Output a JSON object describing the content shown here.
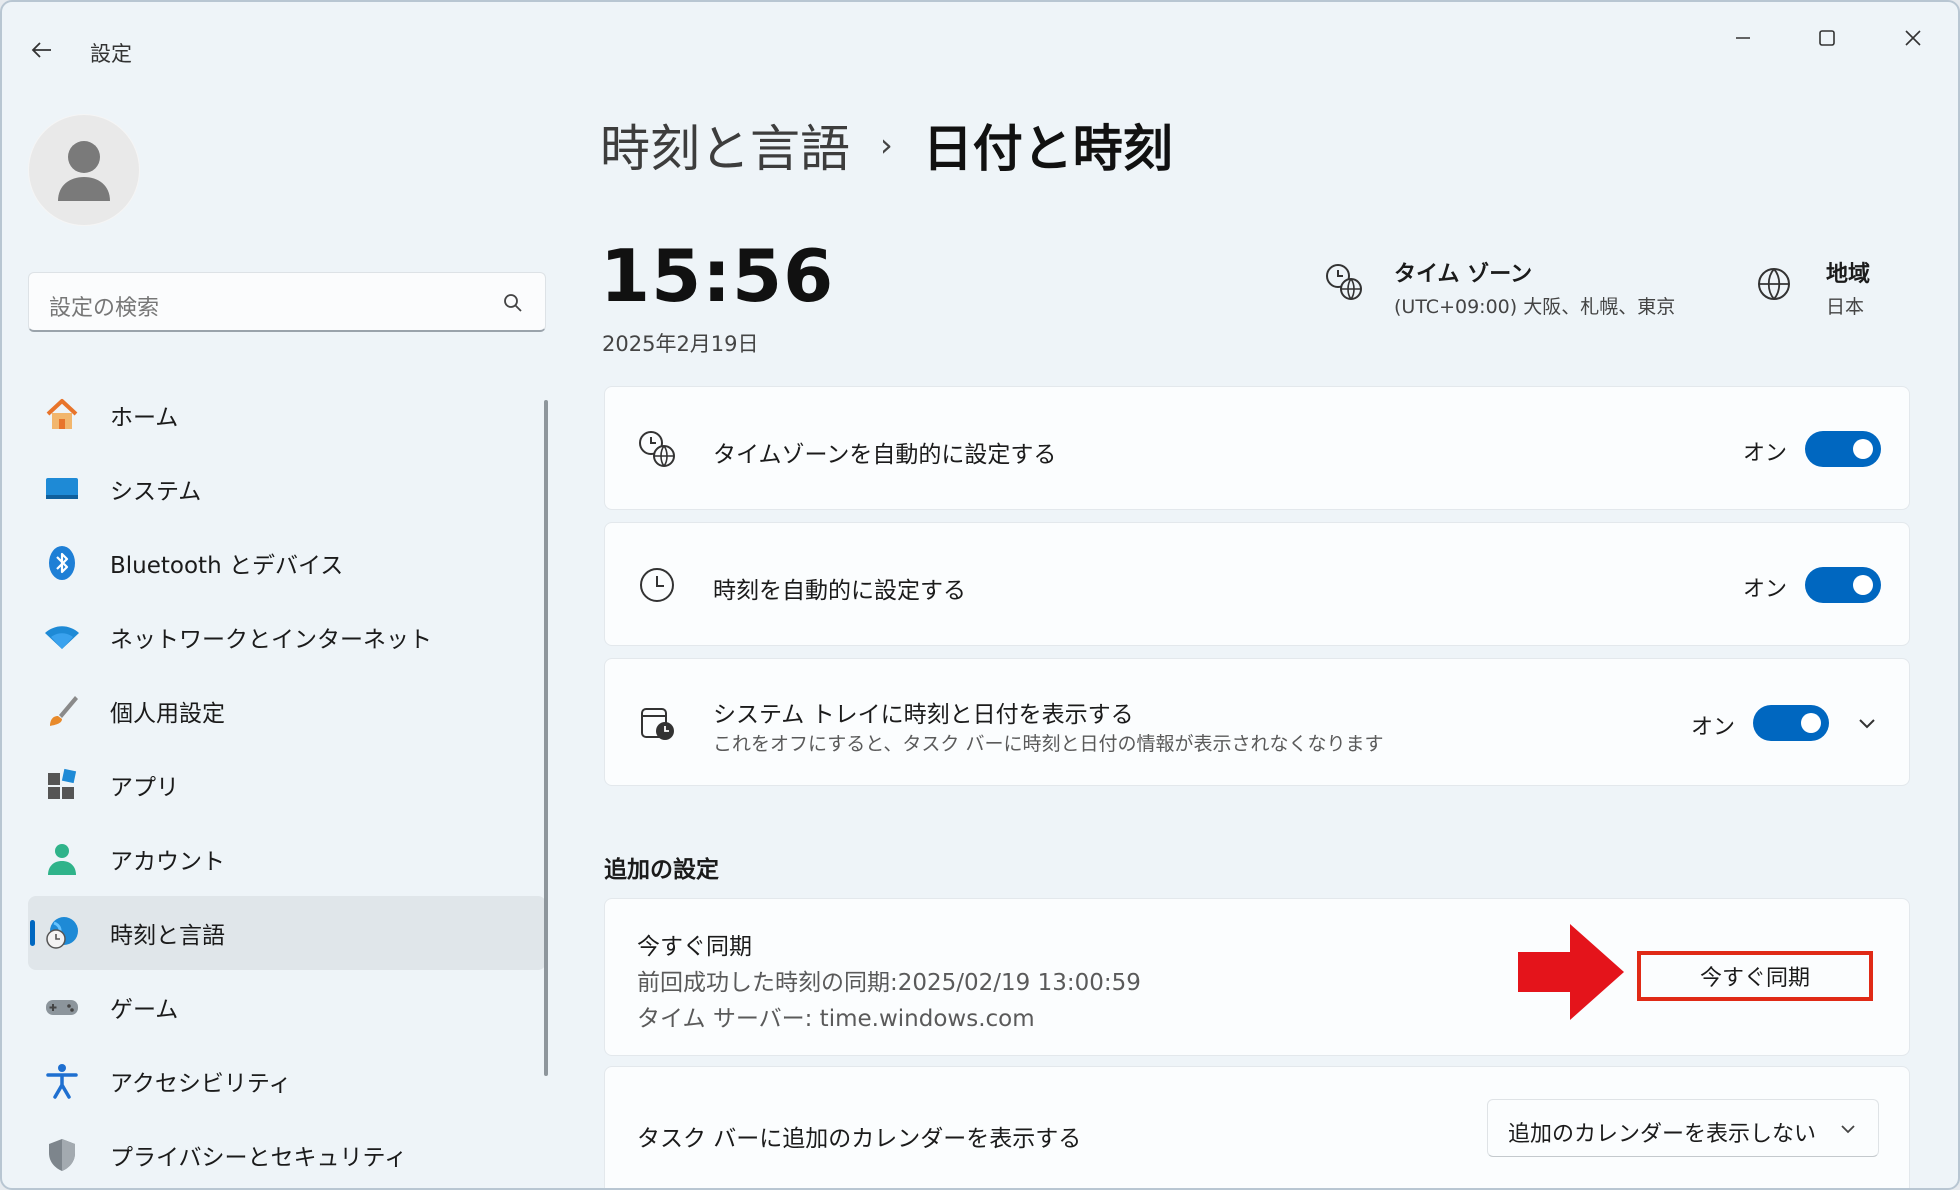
{
  "window": {
    "title": "設定"
  },
  "search": {
    "placeholder": "設定の検索"
  },
  "sidebar": {
    "items": [
      {
        "label": "ホーム",
        "icon": "home-icon"
      },
      {
        "label": "システム",
        "icon": "system-icon"
      },
      {
        "label": "Bluetooth とデバイス",
        "icon": "bluetooth-icon"
      },
      {
        "label": "ネットワークとインターネット",
        "icon": "wifi-icon"
      },
      {
        "label": "個人用設定",
        "icon": "brush-icon"
      },
      {
        "label": "アプリ",
        "icon": "apps-icon"
      },
      {
        "label": "アカウント",
        "icon": "account-icon"
      },
      {
        "label": "時刻と言語",
        "icon": "time-language-icon",
        "active": true
      },
      {
        "label": "ゲーム",
        "icon": "gamepad-icon"
      },
      {
        "label": "アクセシビリティ",
        "icon": "accessibility-icon"
      },
      {
        "label": "プライバシーとセキュリティ",
        "icon": "shield-icon"
      }
    ]
  },
  "breadcrumb": {
    "parent": "時刻と言語",
    "separator": "›",
    "current": "日付と時刻"
  },
  "clock": {
    "time": "15:56",
    "date": "2025年2月19日"
  },
  "timezone": {
    "title": "タイム ゾーン",
    "value": "(UTC+09:00) 大阪、札幌、東京"
  },
  "region": {
    "title": "地域",
    "value": "日本"
  },
  "settings": {
    "auto_timezone": {
      "label": "タイムゾーンを自動的に設定する",
      "state": "オン",
      "on": true
    },
    "auto_time": {
      "label": "時刻を自動的に設定する",
      "state": "オン",
      "on": true
    },
    "tray": {
      "label": "システム トレイに時刻と日付を表示する",
      "sub": "これをオフにすると、タスク バーに時刻と日付の情報が表示されなくなります",
      "state": "オン",
      "on": true
    }
  },
  "additional": {
    "title": "追加の設定",
    "sync": {
      "title": "今すぐ同期",
      "last_sync": "前回成功した時刻の同期:2025/02/19 13:00:59",
      "server": "タイム サーバー: time.windows.com",
      "button": "今すぐ同期"
    },
    "calendar": {
      "label": "タスク バーに追加のカレンダーを表示する",
      "selected": "追加のカレンダーを表示しない"
    }
  },
  "colors": {
    "accent": "#0067c0",
    "highlight": "#e02a16"
  }
}
